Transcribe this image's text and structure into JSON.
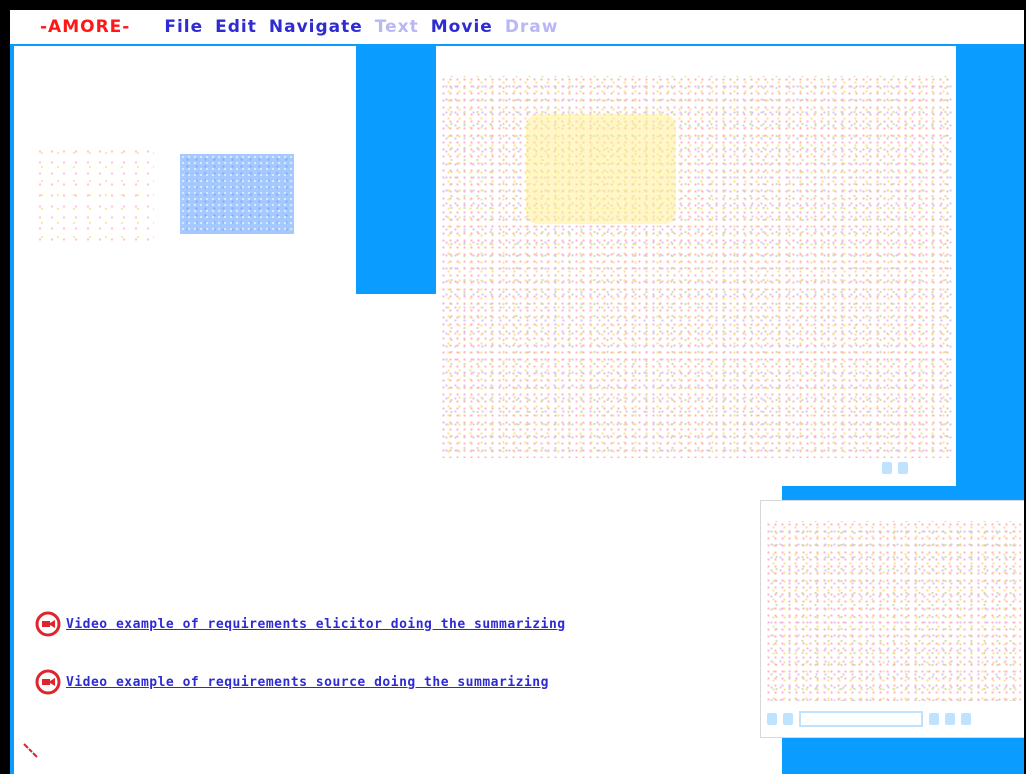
{
  "menubar": {
    "app_name": "-AMORE-",
    "items": [
      {
        "label": "File",
        "enabled": true
      },
      {
        "label": "Edit",
        "enabled": true
      },
      {
        "label": "Navigate",
        "enabled": true
      },
      {
        "label": "Text",
        "enabled": false
      },
      {
        "label": "Movie",
        "enabled": true
      },
      {
        "label": "Draw",
        "enabled": false
      }
    ]
  },
  "links": [
    {
      "label": "Video example of requirements elicitor doing the summarizing",
      "icon": "video-play-icon"
    },
    {
      "label": "Video example of requirements source doing the summarizing",
      "icon": "video-play-icon"
    }
  ],
  "colors": {
    "desktop": "#0a9dff",
    "menu_active": "#2f2bd2",
    "menu_disabled": "#b9b7f5",
    "app_name": "#ff1717",
    "icon_red": "#e0242c"
  }
}
